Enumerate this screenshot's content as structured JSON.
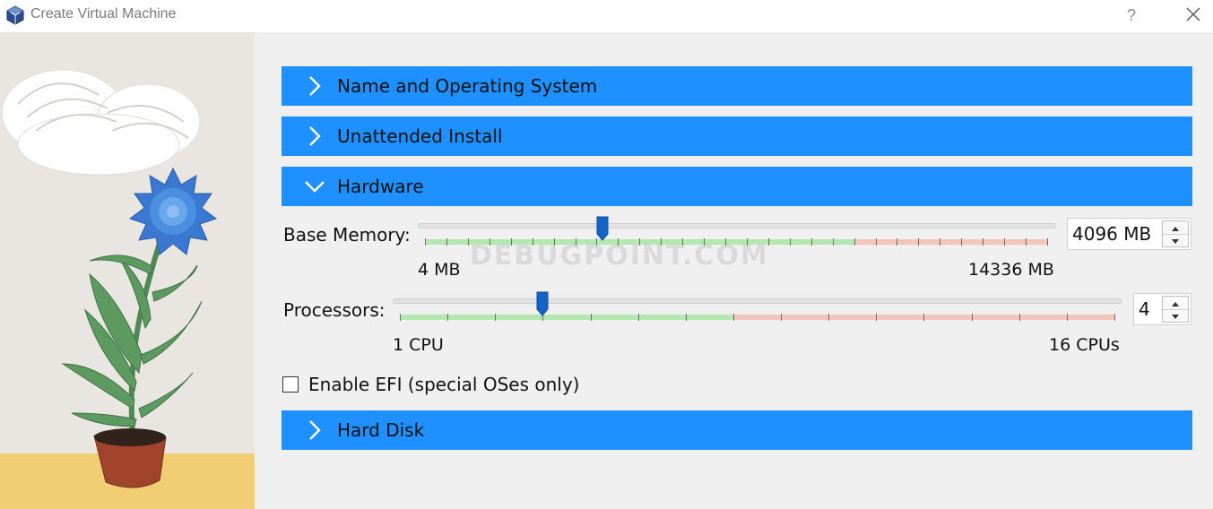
{
  "window": {
    "title": "Create Virtual Machine",
    "help_glyph": "?"
  },
  "sections": {
    "name_os": {
      "label": "Name and Operating System",
      "expanded": false
    },
    "unattended": {
      "label": "Unattended Install",
      "expanded": false
    },
    "hardware": {
      "label": "Hardware",
      "expanded": true
    },
    "hard_disk": {
      "label": "Hard Disk",
      "expanded": false
    }
  },
  "hardware": {
    "memory": {
      "label": "Base Memory:",
      "value": "4096 MB",
      "min_label": "4 MB",
      "max_label": "14336 MB",
      "level_fraction": 0.285
    },
    "processors": {
      "label": "Processors:",
      "value": "4",
      "min_label": "1 CPU",
      "max_label": "16 CPUs",
      "level_fraction": 0.2
    },
    "efi": {
      "label": "Enable EFI (special OSes only)",
      "checked": false
    }
  },
  "watermark": "DEBUGPOINT.COM",
  "colors": {
    "accent": "#1e90ff",
    "slider_ok": "#b4e6b0",
    "slider_warn": "#f2c4bb",
    "handle": "#1464c8"
  }
}
